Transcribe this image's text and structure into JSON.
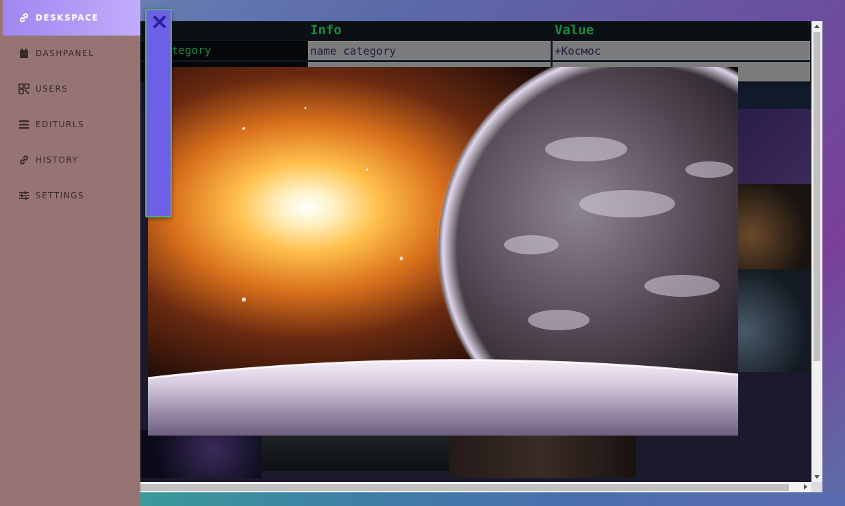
{
  "sidebar": {
    "items": [
      {
        "label": "DESKSPACE",
        "icon": "link-icon",
        "active": true
      },
      {
        "label": "DASHPANEL",
        "icon": "calendar-icon",
        "active": false
      },
      {
        "label": "USERS",
        "icon": "qr-grid-icon",
        "active": false
      },
      {
        "label": "EDITURLS",
        "icon": "list-icon",
        "active": false
      },
      {
        "label": "HISTORY",
        "icon": "link-icon",
        "active": false
      },
      {
        "label": "SETTINGS",
        "icon": "sliders-icon",
        "active": false
      }
    ]
  },
  "table": {
    "headers": [
      "Info",
      "Value"
    ],
    "rows": [
      {
        "key": "ategory",
        "info": "name category",
        "value": "+Космос"
      }
    ]
  },
  "lightbox": {
    "alt_text": "Space wallpaper: bright nebula and planets",
    "close_icon": "close-icon"
  },
  "colors": {
    "sidebar_bg": "#957473",
    "sidebar_active": "#b39af7",
    "header_text": "#1b8a3c",
    "close_panel": "#6d5fe6"
  }
}
